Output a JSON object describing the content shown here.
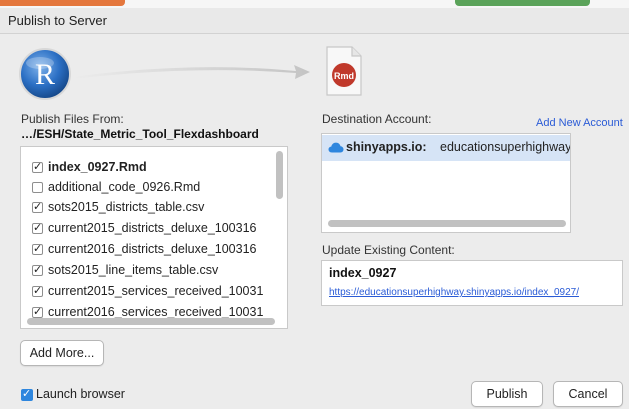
{
  "window": {
    "title": "Publish to Server"
  },
  "source": {
    "label": "Publish Files From:",
    "path": "…/ESH/State_Metric_Tool_Flexdashboard"
  },
  "files": [
    {
      "name": "index_0927.Rmd",
      "checked": true,
      "bold": true
    },
    {
      "name": "additional_code_0926.Rmd",
      "checked": false,
      "bold": false
    },
    {
      "name": "sots2015_districts_table.csv",
      "checked": true,
      "bold": false
    },
    {
      "name": "current2015_districts_deluxe_100316",
      "checked": true,
      "bold": false
    },
    {
      "name": "current2016_districts_deluxe_100316",
      "checked": true,
      "bold": false
    },
    {
      "name": "sots2015_line_items_table.csv",
      "checked": true,
      "bold": false
    },
    {
      "name": "current2015_services_received_10031",
      "checked": true,
      "bold": false
    },
    {
      "name": "current2016_services_received_10031",
      "checked": true,
      "bold": false
    }
  ],
  "rmd_icon_text": "Rmd",
  "r_logo_text": "R",
  "destination": {
    "label": "Destination Account:",
    "add_account": "Add New Account",
    "accounts": [
      {
        "server": "shinyapps.io:",
        "user": "educationsuperhighway",
        "icon": "cloud-icon",
        "selected": true
      }
    ]
  },
  "existing": {
    "label": "Update Existing Content:",
    "name": "index_0927",
    "url": "https://educationsuperhighway.shinyapps.io/index_0927/"
  },
  "buttons": {
    "add_more": "Add More...",
    "publish": "Publish",
    "cancel": "Cancel"
  },
  "launch_browser": {
    "label": "Launch browser",
    "checked": true
  },
  "colors": {
    "accent_blue": "#2e86de",
    "link_blue": "#2a5bd6",
    "selection": "#d6e4f6",
    "r_blue": "#2165b5",
    "rmd_red": "#c0392b"
  }
}
